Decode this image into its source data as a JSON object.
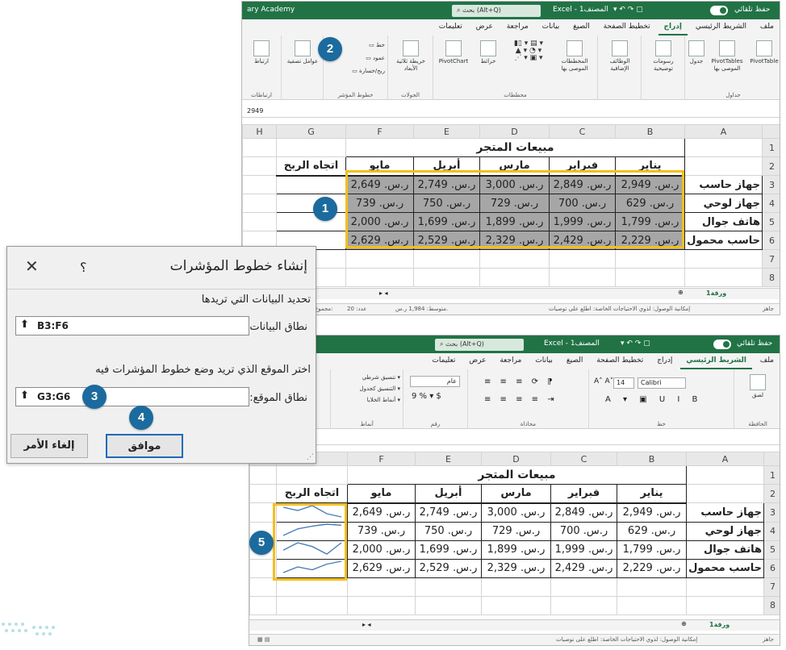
{
  "top_window": {
    "title_left": "ary Academy",
    "search": "بحث (Alt+Q)",
    "title_center": "Excel  -  المصنف1",
    "autosave": "حفظ تلقائي",
    "menu": [
      "ملف",
      "الشريط الرئيسي",
      "إدراج",
      "تخطيط الصفحة",
      "الصيغ",
      "بيانات",
      "مراجعة",
      "عرض",
      "تعليمات"
    ],
    "active_menu": "إدراج",
    "ribbon_groups": [
      "جداول",
      "",
      "",
      "محططات",
      "الجولات",
      "خطوط المؤشر",
      "",
      "ارتباطات"
    ],
    "ribbon_buttons": {
      "pivottable": "PivotTable",
      "recommended_pivot": "PivotTables الموصى بها",
      "table": "جدول",
      "illustrations": "رسومات توضيحية",
      "addins": "الوظائف الإضافية",
      "recommended_charts": "المخططات الموصى بها",
      "pivotchart": "PivotChart",
      "maps": "خرائط",
      "3d_map": "خريطة ثلاثية الأبعاد",
      "sparkline_line": "خط",
      "sparkline_column": "عمود",
      "sparkline_winloss": "ربح/خسارة",
      "filters": "عوامل تصفية",
      "link": "ارتباط"
    },
    "formula_value": "2949",
    "sheet_tab": "ورقة1",
    "status_left": "جاهز",
    "status_access": "إمكانية الوصول: لذوي الاحتياجات الخاصة: اطلع على توصيات",
    "status_avg": "متوسط: 1,984 ر.س.",
    "status_count": "عدد: 20",
    "status_sum": "مجموع:"
  },
  "bottom_window": {
    "search": "بحث (Alt+Q)",
    "title_center": "Excel  -  المصنف1",
    "autosave": "حفظ تلقائي",
    "menu": [
      "ملف",
      "الشريط الرئيسي",
      "إدراج",
      "تخطيط الصفحة",
      "الصيغ",
      "بيانات",
      "مراجعة",
      "عرض",
      "تعليمات"
    ],
    "active_menu": "الشريط الرئيسي",
    "font_name": "Calibri",
    "font_size": "14",
    "number_format": "عام",
    "groups": [
      "الحافظة",
      "خط",
      "محاذاة",
      "رقم",
      "أنماط"
    ],
    "styles": [
      "تنسيق شرطي",
      "التنسيق كجدول",
      "أنماط الخلايا"
    ],
    "paste": "لصق",
    "sheet_tab": "ورقة1",
    "status_left": "جاهز",
    "status_access": "إمكانية الوصول: لذوي الاحتياجات الخاصة: اطلع على توصيات"
  },
  "sheet": {
    "col_headers": [
      "A",
      "B",
      "C",
      "D",
      "E",
      "F",
      "G",
      "H"
    ],
    "title": "مبيعات المتجر",
    "months": [
      "يناير",
      "فبراير",
      "مارس",
      "أبريل",
      "مايو"
    ],
    "trend_header": "اتجاه الربح",
    "rows": [
      {
        "name": "جهاز حاسب",
        "values": [
          "ر.س. 2,949",
          "ر.س. 2,849",
          "ر.س. 3,000",
          "ر.س. 2,749",
          "ر.س. 2,649"
        ],
        "spark": [
          2949,
          2849,
          3000,
          2749,
          2649
        ]
      },
      {
        "name": "جهاز لوحي",
        "values": [
          "ر.س. 629",
          "ر.س. 700",
          "ر.س. 729",
          "ر.س. 750",
          "ر.س. 739"
        ],
        "spark": [
          629,
          700,
          729,
          750,
          739
        ]
      },
      {
        "name": "هاتف جوال",
        "values": [
          "ر.س. 1,799",
          "ر.س. 1,999",
          "ر.س. 1,899",
          "ر.س. 1,699",
          "ر.س. 2,000"
        ],
        "spark": [
          1799,
          1999,
          1899,
          1699,
          2000
        ]
      },
      {
        "name": "حاسب محمول",
        "values": [
          "ر.س. 2,229",
          "ر.س. 2,429",
          "ر.س. 2,329",
          "ر.س. 2,529",
          "ر.س. 2,629"
        ],
        "spark": [
          2229,
          2429,
          2329,
          2529,
          2629
        ]
      }
    ],
    "row_numbers": [
      "1",
      "2",
      "3",
      "4",
      "5",
      "6",
      "7",
      "8"
    ]
  },
  "dialog": {
    "title": "إنشاء خطوط المؤشرات",
    "help": "؟",
    "close": "✕",
    "section_data": "تحديد البيانات التي تريدها",
    "data_range_label": "نطاق البيانات:",
    "data_range_value": "B3:F6",
    "section_location": "اختر الموقع الذي تريد وضع خطوط المؤشرات فيه",
    "location_label": "نطاق الموقع:",
    "location_value": "G3:G6",
    "ok": "موافق",
    "cancel": "إلغاء الأمر"
  },
  "badges": [
    "1",
    "2",
    "3",
    "4",
    "5"
  ],
  "colors": {
    "excel_green": "#217346",
    "highlight": "#f2bf21",
    "badge": "#1b6b9e",
    "selection": "#a6a6a6"
  }
}
